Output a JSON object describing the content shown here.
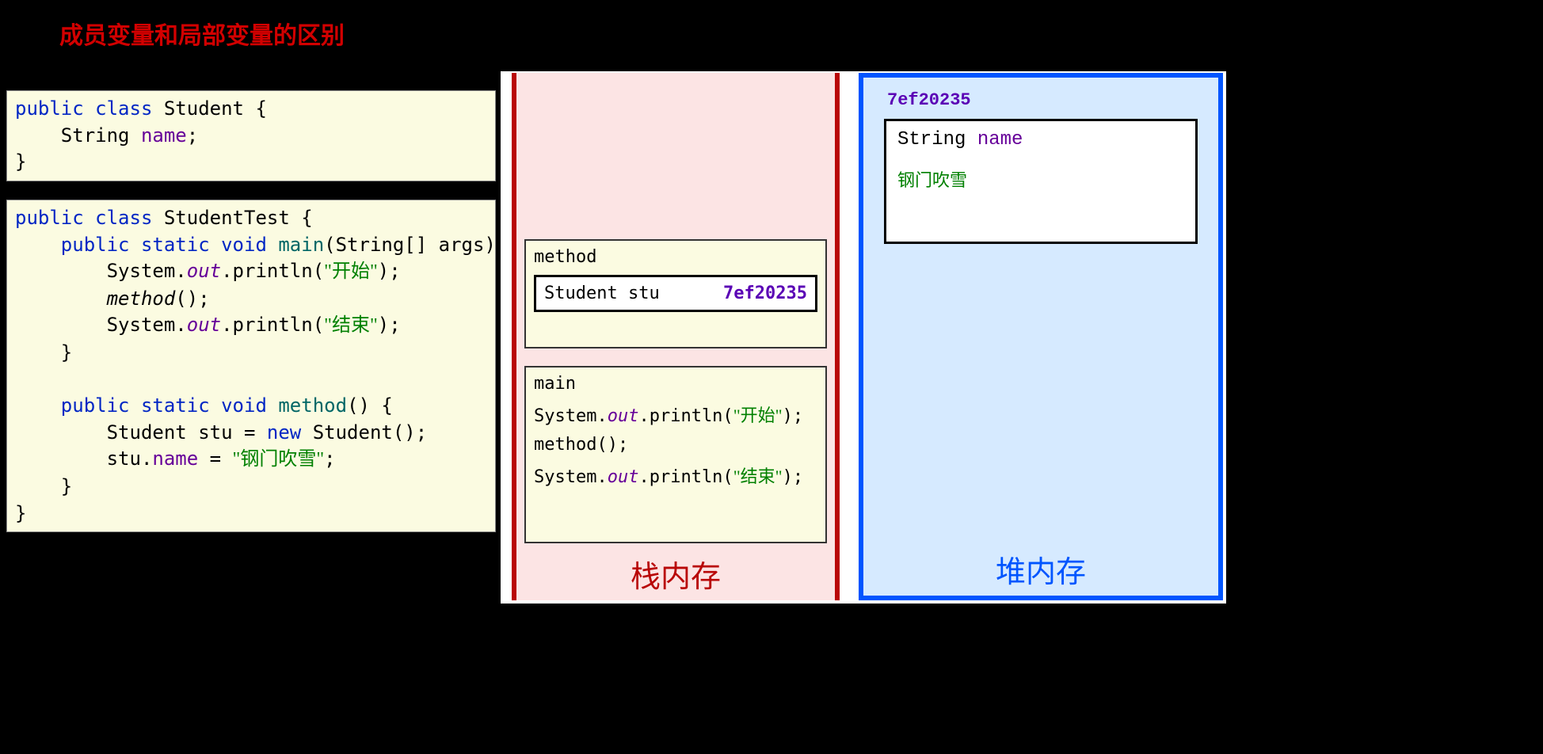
{
  "title": "成员变量和局部变量的区别",
  "codeA": {
    "l1_a": "public",
    "l1_b": "class",
    "l1_c": " Student {",
    "l2_a": "    String ",
    "l2_b": "name",
    "l2_c": ";",
    "l3": "}"
  },
  "codeB": {
    "l1_a": "public",
    "l1_b": "class",
    "l1_c": " StudentTest {",
    "l2_a": "    ",
    "l2_b": "public",
    "l2_c": "static",
    "l2_d": "void",
    "l2_e": "main",
    "l2_f": "(String[] args) {",
    "l3_a": "        System.",
    "l3_b": "out",
    "l3_c": ".println(",
    "l3_d": "\"开始\"",
    "l3_e": ");",
    "l4_a": "        ",
    "l4_b": "method",
    "l4_c": "();",
    "l5_a": "        System.",
    "l5_b": "out",
    "l5_c": ".println(",
    "l5_d": "\"结束\"",
    "l5_e": ");",
    "l6": "    }",
    "l7": "",
    "l8_a": "    ",
    "l8_b": "public",
    "l8_c": "static",
    "l8_d": "void",
    "l8_e": "method",
    "l8_f": "() {",
    "l9_a": "        Student stu = ",
    "l9_b": "new",
    "l9_c": " Student();",
    "l10_a": "        stu.",
    "l10_b": "name",
    "l10_c": " = ",
    "l10_d": "\"钢门吹雪\"",
    "l10_e": ";",
    "l11": "    }",
    "l12": "}"
  },
  "stack": {
    "label": "栈内存",
    "method": {
      "title": "method",
      "var": "Student stu",
      "addr": "7ef20235"
    },
    "main": {
      "title": "main",
      "l1_a": "System.",
      "l1_b": "out",
      "l1_c": ".println(",
      "l1_d": "\"开始\"",
      "l1_e": ");",
      "l2": "method();",
      "l3_a": "System.",
      "l3_b": "out",
      "l3_c": ".println(",
      "l3_d": "\"结束\"",
      "l3_e": ");"
    }
  },
  "heap": {
    "label": "堆内存",
    "addr": "7ef20235",
    "obj_type": "String ",
    "obj_field": "name",
    "obj_value": "钢门吹雪"
  }
}
